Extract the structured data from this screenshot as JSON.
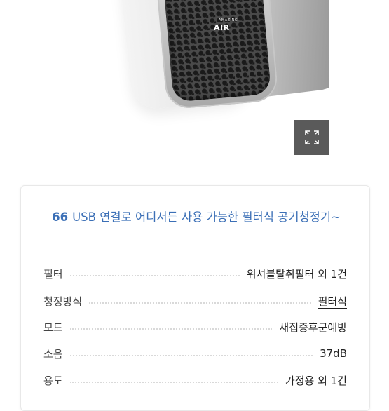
{
  "product_image": {
    "brand_small": "AMAZING",
    "brand": "AIR",
    "expand_icon": "expand-icon"
  },
  "spec_card": {
    "quote_mark": "66",
    "headline": "USB 연결로 어디서든 사용 가능한 필터식 공기청정기~",
    "rows": [
      {
        "label": "필터",
        "value": "워셔블탈취필터 외 1건"
      },
      {
        "label": "청정방식",
        "value": "필터식"
      },
      {
        "label": "모드",
        "value": "새집증후군예방"
      },
      {
        "label": "소음",
        "value": "37dB"
      },
      {
        "label": "용도",
        "value": "가정용 외 1건"
      }
    ]
  },
  "colors": {
    "accent": "#3b6fb6",
    "expand_button_bg": "#5a5a5a"
  }
}
